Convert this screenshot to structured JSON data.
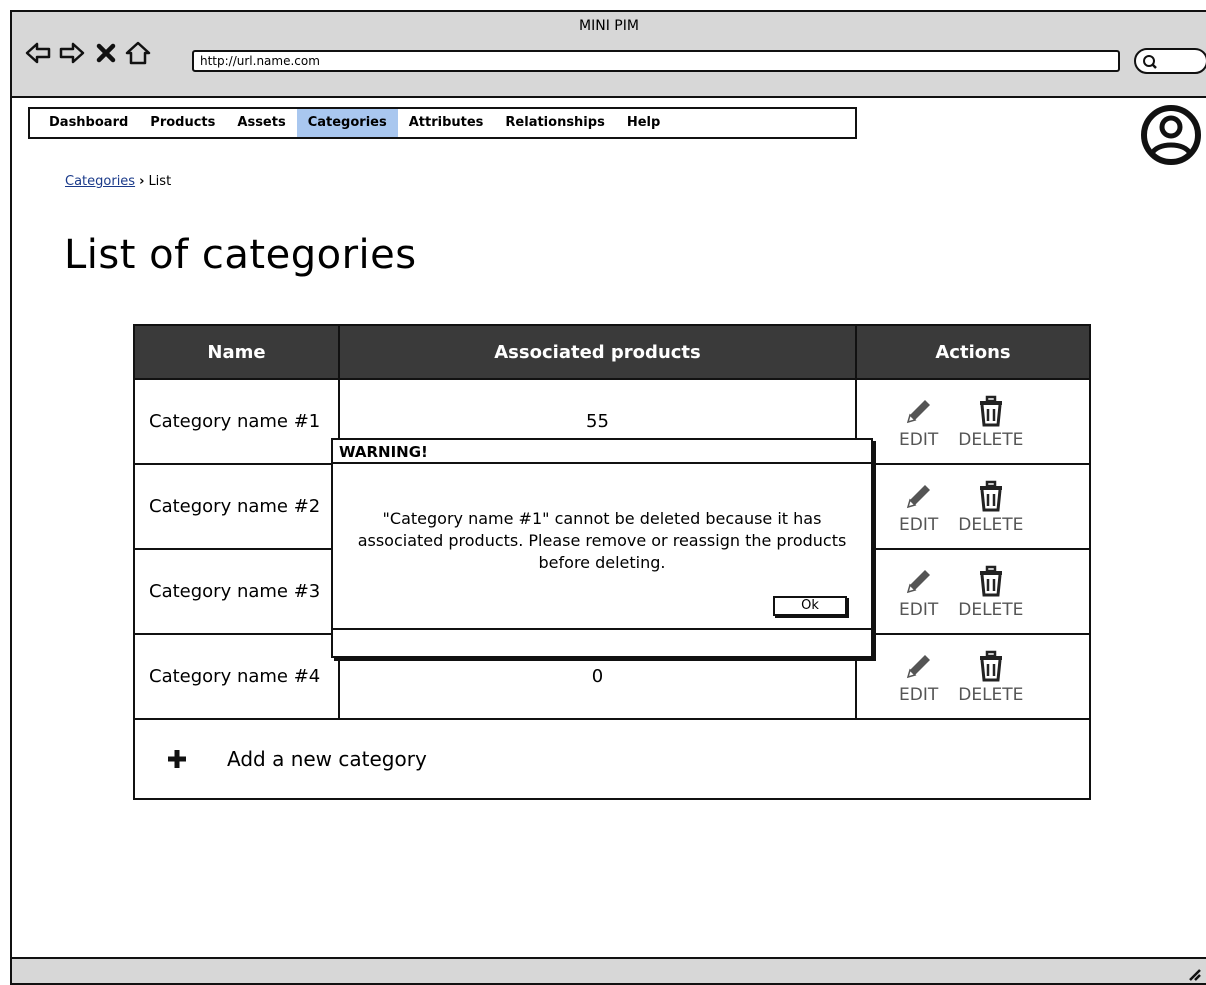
{
  "window": {
    "title": "MINI PIM",
    "url": "http://url.name.com"
  },
  "menu": {
    "items": [
      {
        "label": "Dashboard",
        "active": false
      },
      {
        "label": "Products",
        "active": false
      },
      {
        "label": "Assets",
        "active": false
      },
      {
        "label": "Categories",
        "active": true
      },
      {
        "label": "Attributes",
        "active": false
      },
      {
        "label": "Relationships",
        "active": false
      },
      {
        "label": "Help",
        "active": false
      }
    ]
  },
  "breadcrumb": {
    "parent": "Categories",
    "current": "List"
  },
  "page": {
    "title": "List of categories"
  },
  "table": {
    "headers": {
      "name": "Name",
      "products": "Associated products",
      "actions": "Actions"
    },
    "rows": [
      {
        "name": "Category name #1",
        "products": "55"
      },
      {
        "name": "Category name #2",
        "products": ""
      },
      {
        "name": "Category name #3",
        "products": ""
      },
      {
        "name": "Category name #4",
        "products": "0"
      }
    ],
    "edit_label": "EDIT",
    "delete_label": "DELETE",
    "add_label": "Add a new category"
  },
  "dialog": {
    "title": "WARNING!",
    "message": "\"Category name #1\" cannot be deleted because it has associated products. Please remove or reassign the products before deleting.",
    "ok_label": "Ok"
  },
  "colors": {
    "active_menu": "#a9c7ef",
    "header_bg": "#3a3a3a",
    "chrome": "#d7d7d7",
    "link": "#1a3a8a"
  },
  "icons": [
    "back-arrow-icon",
    "forward-arrow-icon",
    "stop-icon",
    "home-icon",
    "search-icon",
    "user-avatar-icon",
    "pencil-icon",
    "trash-icon",
    "plus-icon",
    "resize-grip-icon"
  ]
}
